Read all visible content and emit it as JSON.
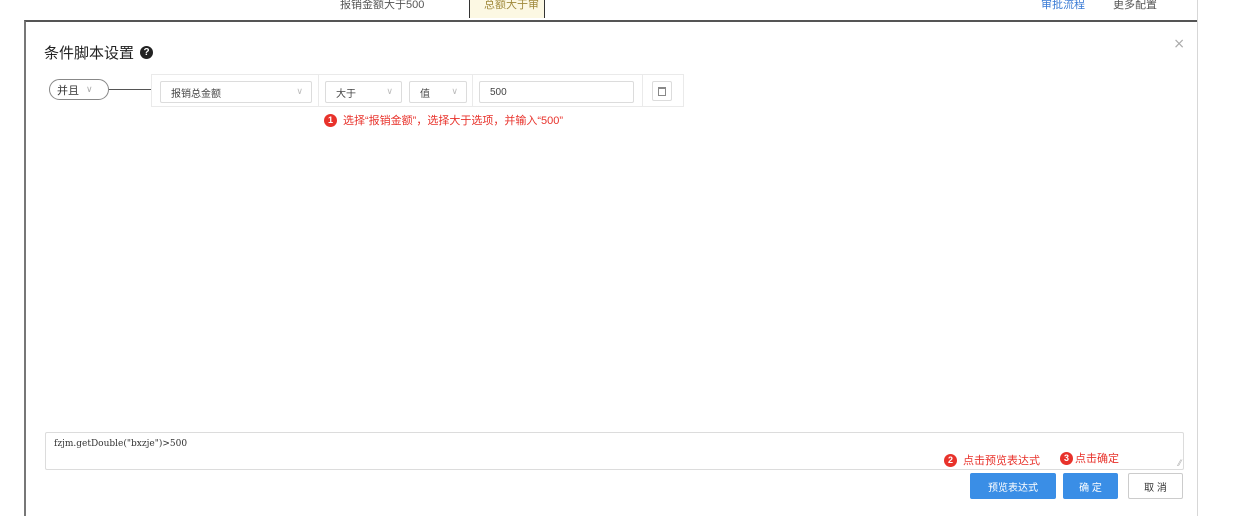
{
  "background": {
    "ghost_1": "报销金额大于500",
    "ghost_2": "总额大于审",
    "ghost_3": "审批流程",
    "ghost_4": "更多配置"
  },
  "dialog": {
    "title": "条件脚本设置",
    "help_icon": "?",
    "close_icon": "×"
  },
  "logic": {
    "operator": "并且",
    "chevron": "∨"
  },
  "condition": {
    "field": "报销总金额",
    "comparator": "大于",
    "value_type": "值",
    "value": "500",
    "chevron": "∨"
  },
  "annotations": {
    "step1_num": "1",
    "step1": "选择“报销金额”，选择大于选项，并输入“500”",
    "step2_num": "2",
    "step2": "点击预览表达式",
    "step3_num": "3",
    "step3": "点击确定"
  },
  "expression": {
    "text": "fzjm.getDouble(\"bxzje\")>500",
    "resize_glyph": "⁄⁄"
  },
  "footer": {
    "preview_label": "预览表达式",
    "ok_label": "确 定",
    "cancel_label": "取 消"
  },
  "colors": {
    "primary": "#3a8ee6",
    "annotation": "#e8322b"
  },
  "icons": {
    "help": "help-icon",
    "close": "close-icon",
    "delete": "trash-icon",
    "dropdown": "chevron-down-icon"
  }
}
